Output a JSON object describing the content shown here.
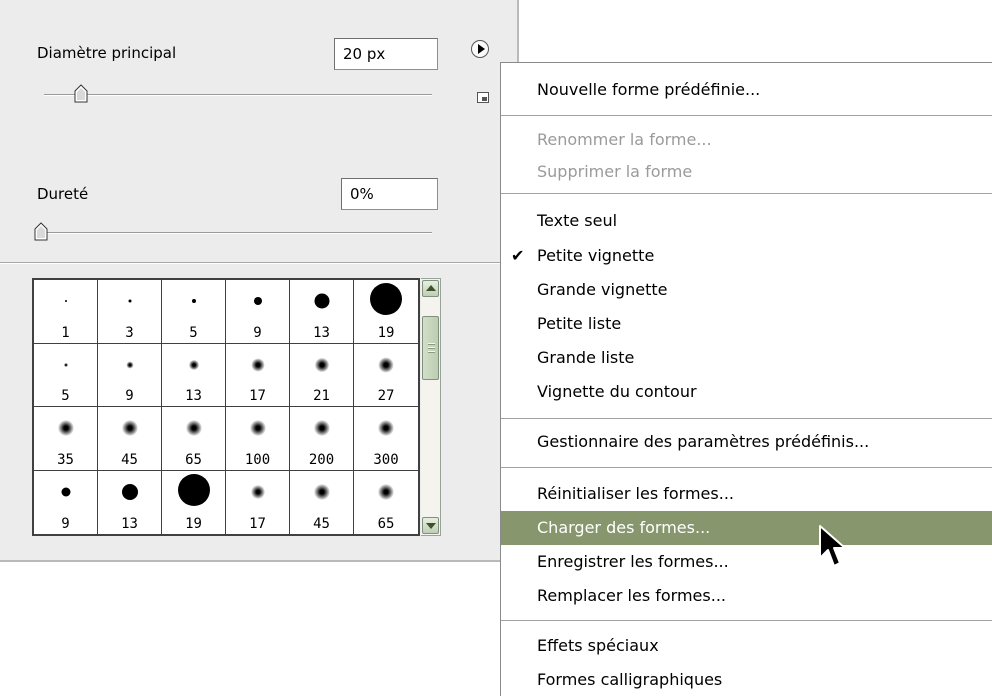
{
  "panel": {
    "master_diameter_label": "Diamètre principal",
    "master_diameter_value": "20 px",
    "hardness_label": "Dureté",
    "hardness_value": "0%",
    "brushes": [
      {
        "size": "1"
      },
      {
        "size": "3"
      },
      {
        "size": "5"
      },
      {
        "size": "9"
      },
      {
        "size": "13"
      },
      {
        "size": "19"
      },
      {
        "size": "5"
      },
      {
        "size": "9"
      },
      {
        "size": "13"
      },
      {
        "size": "17"
      },
      {
        "size": "21"
      },
      {
        "size": "27"
      },
      {
        "size": "35"
      },
      {
        "size": "45"
      },
      {
        "size": "65"
      },
      {
        "size": "100"
      },
      {
        "size": "200"
      },
      {
        "size": "300"
      },
      {
        "size": "9"
      },
      {
        "size": "13"
      },
      {
        "size": "19"
      },
      {
        "size": "17"
      },
      {
        "size": "45"
      },
      {
        "size": "65"
      }
    ]
  },
  "menu": {
    "items": [
      {
        "label": "Nouvelle forme prédéfinie..."
      },
      {
        "label": "Renommer la forme..."
      },
      {
        "label": "Supprimer la forme"
      },
      {
        "label": "Texte seul"
      },
      {
        "label": "Petite vignette",
        "check": "✔"
      },
      {
        "label": "Grande vignette"
      },
      {
        "label": "Petite liste"
      },
      {
        "label": "Grande liste"
      },
      {
        "label": "Vignette du contour"
      },
      {
        "label": "Gestionnaire des paramètres prédéfinis..."
      },
      {
        "label": "Réinitialiser les formes..."
      },
      {
        "label": "Charger des formes..."
      },
      {
        "label": "Enregistrer les formes..."
      },
      {
        "label": "Remplacer les formes..."
      },
      {
        "label": "Effets spéciaux"
      },
      {
        "label": "Formes calligraphiques"
      }
    ]
  },
  "colors": {
    "panel_bg": "#ececec",
    "menu_highlight": "#87966d",
    "disabled_text": "#9a9a9a",
    "scrollbar_accent": "#bccdb0"
  }
}
